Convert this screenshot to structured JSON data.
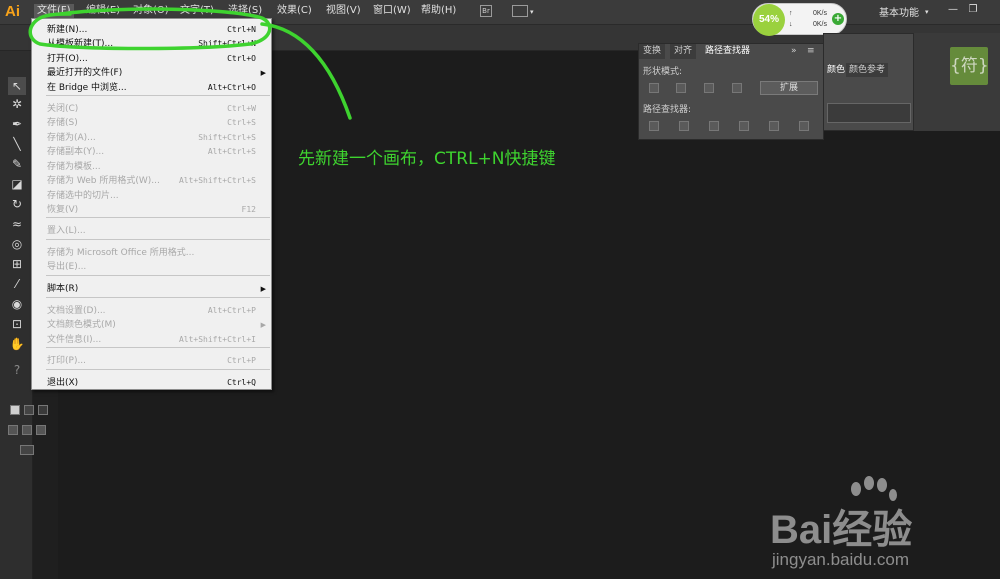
{
  "app": {
    "logo": "Ai",
    "workspace": "基本功能"
  },
  "menubar": {
    "items": [
      "文件(F)",
      "编辑(E)",
      "对象(O)",
      "文字(T)",
      "选择(S)",
      "效果(C)",
      "视图(V)",
      "窗口(W)",
      "帮助(H)"
    ],
    "bridge_icon": "Br"
  },
  "file_menu": {
    "items": [
      {
        "label": "新建(N)...",
        "shortcut": "Ctrl+N",
        "state": "enabled"
      },
      {
        "label": "从模板新建(T)...",
        "shortcut": "Shift+Ctrl+N",
        "state": "enabled"
      },
      {
        "label": "打开(O)...",
        "shortcut": "Ctrl+O",
        "state": "enabled"
      },
      {
        "label": "最近打开的文件(F)",
        "shortcut": "",
        "state": "enabled",
        "submenu": true
      },
      {
        "label": "在 Bridge 中浏览...",
        "shortcut": "Alt+Ctrl+O",
        "state": "enabled"
      },
      {
        "label": "关闭(C)",
        "shortcut": "Ctrl+W",
        "state": "disabled"
      },
      {
        "label": "存储(S)",
        "shortcut": "Ctrl+S",
        "state": "disabled"
      },
      {
        "label": "存储为(A)...",
        "shortcut": "Shift+Ctrl+S",
        "state": "disabled"
      },
      {
        "label": "存储副本(Y)...",
        "shortcut": "Alt+Ctrl+S",
        "state": "disabled"
      },
      {
        "label": "存储为模板...",
        "shortcut": "",
        "state": "disabled"
      },
      {
        "label": "存储为 Web 所用格式(W)...",
        "shortcut": "Alt+Shift+Ctrl+S",
        "state": "disabled"
      },
      {
        "label": "存储选中的切片...",
        "shortcut": "",
        "state": "disabled"
      },
      {
        "label": "恢复(V)",
        "shortcut": "F12",
        "state": "disabled"
      },
      {
        "label": "置入(L)...",
        "shortcut": "",
        "state": "disabled"
      },
      {
        "label": "存储为 Microsoft Office 所用格式...",
        "shortcut": "",
        "state": "disabled"
      },
      {
        "label": "导出(E)...",
        "shortcut": "",
        "state": "disabled"
      },
      {
        "label": "脚本(R)",
        "shortcut": "",
        "state": "enabled",
        "submenu": true
      },
      {
        "label": "文档设置(D)...",
        "shortcut": "Alt+Ctrl+P",
        "state": "disabled"
      },
      {
        "label": "文档颜色模式(M)",
        "shortcut": "",
        "state": "disabled",
        "submenu": true
      },
      {
        "label": "文件信息(I)...",
        "shortcut": "Alt+Shift+Ctrl+I",
        "state": "disabled"
      },
      {
        "label": "打印(P)...",
        "shortcut": "Ctrl+P",
        "state": "disabled"
      },
      {
        "label": "退出(X)",
        "shortcut": "Ctrl+Q",
        "state": "enabled"
      }
    ]
  },
  "pathfinder_panel": {
    "tabs": [
      "变换",
      "对齐",
      "路径查找器"
    ],
    "shape_modes_label": "形状模式:",
    "pathfinders_label": "路径查找器:",
    "expand_label": "扩展"
  },
  "color_panel": {
    "tabs": [
      "颜色",
      "颜色参考"
    ]
  },
  "glyph_button": "{符}",
  "net_widget": {
    "percent": "54%",
    "up": "0K/s",
    "down": "0K/s"
  },
  "annotation": {
    "text": "先新建一个画布，CTRL+N快捷键",
    "color": "#3ed32f"
  },
  "watermark": {
    "brand": "Bai经验",
    "site": "jingyan.baidu.com"
  }
}
